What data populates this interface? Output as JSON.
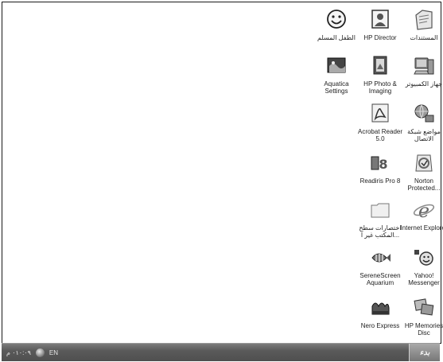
{
  "desktop": {
    "icons": [
      {
        "label": "المستندات",
        "icon": "documents-folder-icon"
      },
      {
        "label": "HP Director",
        "icon": "hp-director-icon"
      },
      {
        "label": "الطفل المسلم",
        "icon": "smiley-app-icon"
      },
      {
        "label": "جهاز الكمبيوتر",
        "icon": "computer-icon"
      },
      {
        "label": "HP Photo & Imaging",
        "icon": "hp-photo-imaging-icon"
      },
      {
        "label": "Aquatica Settings",
        "icon": "aquatica-settings-icon"
      },
      {
        "label": "مواضع شبكة الاتصال",
        "icon": "network-places-icon"
      },
      {
        "label": "Acrobat Reader 5.0",
        "icon": "acrobat-reader-icon"
      },
      {
        "label": "Norton Protected...",
        "icon": "norton-protected-icon"
      },
      {
        "label": "Readiris Pro 8",
        "icon": "readiris-icon"
      },
      {
        "label": "Internet Explorer",
        "icon": "internet-explorer-icon"
      },
      {
        "label": "اختصارات سطح المكتب غير ا...",
        "icon": "desktop-shortcuts-folder-icon"
      },
      {
        "label": "Yahoo! Messenger",
        "icon": "yahoo-messenger-icon"
      },
      {
        "label": "SereneScreen Aquarium",
        "icon": "serenescreen-aquarium-icon"
      },
      {
        "label": "HP Memories Disc",
        "icon": "hp-memories-disc-icon"
      },
      {
        "label": "Nero Express",
        "icon": "nero-express-icon"
      }
    ]
  },
  "taskbar": {
    "clock": "٠١٠:٠٩ م",
    "language": "EN",
    "start_label": "بدء"
  }
}
